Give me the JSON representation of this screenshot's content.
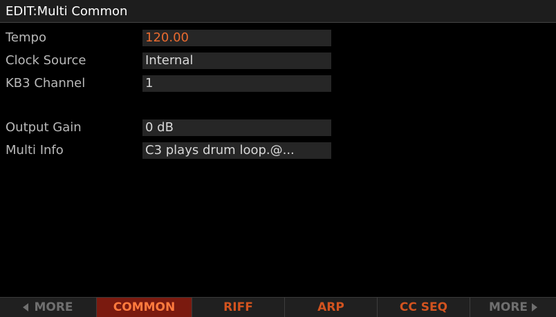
{
  "header": {
    "title": "EDIT:Multi Common"
  },
  "params": [
    {
      "label": "Tempo",
      "value": "120.00"
    },
    {
      "label": "Clock Source",
      "value": "Internal"
    },
    {
      "label": "KB3 Channel",
      "value": "1"
    },
    {
      "label": "Output Gain",
      "value": "0 dB"
    },
    {
      "label": "Multi Info",
      "value": "C3 plays drum loop.@..."
    }
  ],
  "softbuttons": {
    "more_left": "MORE",
    "common": "COMMON",
    "riff": "RIFF",
    "arp": "ARP",
    "ccseq": "CC SEQ",
    "more_right": "MORE"
  },
  "colors": {
    "selected_value": "#e86a2f",
    "active_tab_bg": "#7a1a0f",
    "tab_text": "#d2531f",
    "background": "#000000"
  },
  "icons": {
    "left": "arrow-left-icon",
    "right": "arrow-right-icon"
  }
}
